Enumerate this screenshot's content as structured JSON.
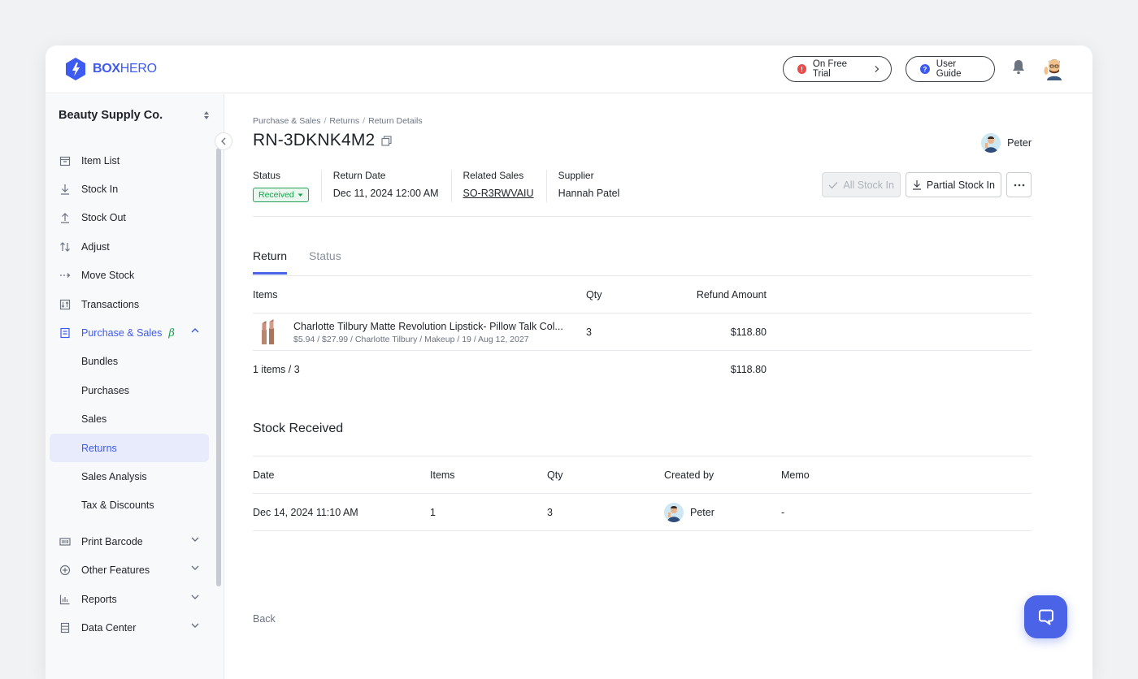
{
  "app": {
    "brand_bold": "BOX",
    "brand_light": "HERO",
    "brand_color": "#3d5af1"
  },
  "header": {
    "trial_label": "On Free Trial",
    "guide_label": "User Guide"
  },
  "sidebar": {
    "org_name": "Beauty Supply Co.",
    "items": [
      {
        "label": "Item List",
        "icon": "box-icon"
      },
      {
        "label": "Stock In",
        "icon": "arrow-down-icon"
      },
      {
        "label": "Stock Out",
        "icon": "arrow-up-icon"
      },
      {
        "label": "Adjust",
        "icon": "adjust-icon"
      },
      {
        "label": "Move Stock",
        "icon": "move-icon"
      },
      {
        "label": "Transactions",
        "icon": "transactions-icon"
      },
      {
        "label": "Purchase & Sales",
        "icon": "document-icon",
        "badge": "β"
      },
      {
        "label": "Bundles"
      },
      {
        "label": "Purchases"
      },
      {
        "label": "Sales"
      },
      {
        "label": "Returns"
      },
      {
        "label": "Sales Analysis"
      },
      {
        "label": "Tax & Discounts"
      },
      {
        "label": "Print Barcode",
        "icon": "barcode-icon"
      },
      {
        "label": "Other Features",
        "icon": "plus-circle-icon"
      },
      {
        "label": "Reports",
        "icon": "bar-chart-icon"
      },
      {
        "label": "Data Center",
        "icon": "database-icon"
      }
    ]
  },
  "breadcrumb": [
    "Purchase & Sales",
    "Returns",
    "Return Details"
  ],
  "return": {
    "id": "RN-3DKNK4M2",
    "owner": "Peter",
    "status_label": "Status",
    "status_value": "Received",
    "return_date_label": "Return Date",
    "return_date": "Dec 11, 2024 12:00 AM",
    "related_sales_label": "Related Sales",
    "related_sales": "SO-R3RWVAIU",
    "supplier_label": "Supplier",
    "supplier": "Hannah Patel"
  },
  "actions": {
    "all_stock_in": "All Stock In",
    "partial_stock_in": "Partial Stock In"
  },
  "tabs": [
    {
      "label": "Return",
      "active": true
    },
    {
      "label": "Status",
      "active": false
    }
  ],
  "items_table": {
    "headers": {
      "items": "Items",
      "qty": "Qty",
      "refund": "Refund Amount"
    },
    "rows": [
      {
        "name": "Charlotte Tilbury Matte Revolution Lipstick- Pillow Talk Col...",
        "details": "$5.94 / $27.99 / Charlotte Tilbury / Makeup / 19 / Aug 12, 2027",
        "qty": "3",
        "refund": "$118.80"
      }
    ],
    "summary": {
      "count": "1 items / 3",
      "total": "$118.80"
    }
  },
  "stock_received": {
    "title": "Stock Received",
    "headers": {
      "date": "Date",
      "items": "Items",
      "qty": "Qty",
      "created_by": "Created by",
      "memo": "Memo"
    },
    "rows": [
      {
        "date": "Dec 14, 2024 11:10 AM",
        "items": "1",
        "qty": "3",
        "created_by": "Peter",
        "memo": "-"
      }
    ]
  },
  "footer": {
    "back_label": "Back"
  }
}
